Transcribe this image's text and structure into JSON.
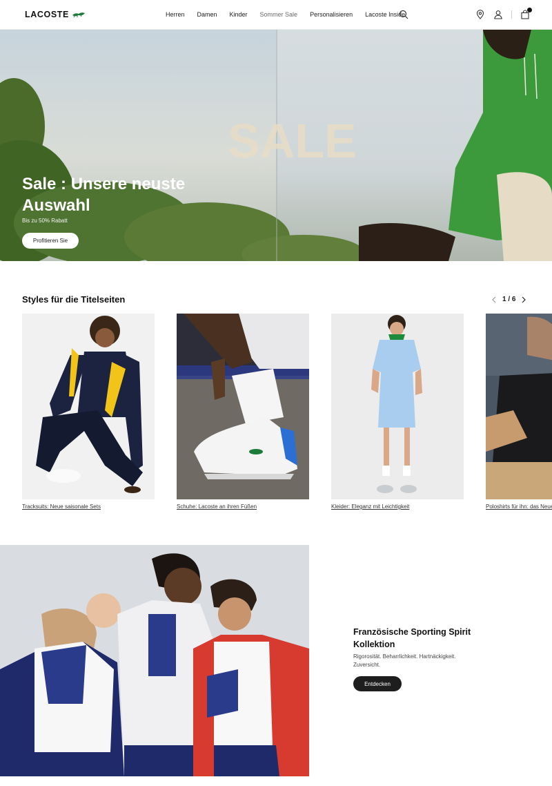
{
  "brand": {
    "name": "LACOSTE",
    "icon": "crocodile-logo"
  },
  "nav": {
    "items": [
      {
        "label": "Herren"
      },
      {
        "label": "Damen"
      },
      {
        "label": "Kinder"
      },
      {
        "label": "Sommer Sale"
      },
      {
        "label": "Personalisieren"
      },
      {
        "label": "Lacoste Inside"
      }
    ],
    "icons": [
      "search-icon",
      "store-locator-icon",
      "account-icon",
      "cart-icon"
    ]
  },
  "hero": {
    "title": "Sale : Unsere neuste Auswahl",
    "subtitle": "Bis zu 50% Rabatt",
    "button": "Profitieren Sie",
    "overlay_word": "SALE"
  },
  "styles": {
    "title": "Styles für die Titelseiten",
    "pager": "1 / 6",
    "cards": [
      {
        "caption": "Tracksuits: Neue saisonale Sets"
      },
      {
        "caption": "Schuhe: Lacoste an ihren Füßen"
      },
      {
        "caption": "Kleider: Eleganz mit Leichtigkeit"
      },
      {
        "caption": "Poloshirts für ihn: das Neue"
      }
    ]
  },
  "feature": {
    "title": "Französische Sporting Spirit Kollektion",
    "text": "Rigorosität. Beharrlichkeit. Hartnäckigkeit. Zuversicht.",
    "button": "Entdecken"
  },
  "colors": {
    "brand_green": "#1e7a3a",
    "dark_button": "#1e1e1e"
  }
}
